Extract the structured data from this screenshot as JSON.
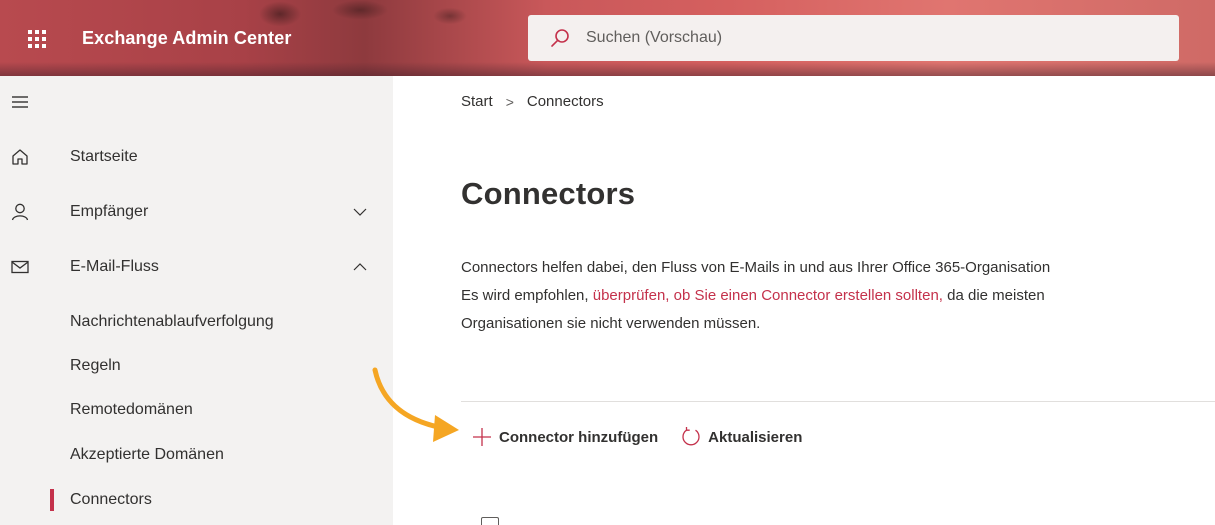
{
  "header": {
    "app_title": "Exchange Admin Center",
    "search_placeholder": "Suchen (Vorschau)",
    "launcher_icon": "waffle-icon",
    "search_icon": "search-icon"
  },
  "sidebar": {
    "collapse_icon": "hamburger-icon",
    "items": [
      {
        "label": "Startseite",
        "icon": "home-icon"
      },
      {
        "label": "Empfänger",
        "icon": "person-icon",
        "chevron": "chevron-down-icon"
      },
      {
        "label": "E-Mail-Fluss",
        "icon": "mail-icon",
        "chevron": "chevron-up-icon"
      }
    ],
    "subitems": [
      {
        "label": "Nachrichtenablaufverfolgung"
      },
      {
        "label": "Regeln"
      },
      {
        "label": "Remotedomänen"
      },
      {
        "label": "Akzeptierte Domänen"
      },
      {
        "label": "Connectors",
        "selected": true
      }
    ]
  },
  "main": {
    "breadcrumb": {
      "root": "Start",
      "separator": ">",
      "current": "Connectors"
    },
    "title": "Connectors",
    "description": {
      "line1": "Connectors helfen dabei, den Fluss von E-Mails in und aus Ihrer Office 365-Organisation",
      "line2_before": "Es wird empfohlen, ",
      "line2_link": "überprüfen, ob Sie einen Connector erstellen sollten,",
      "line2_after": " da die meisten",
      "line3": "Organisationen sie nicht verwenden müssen."
    },
    "commands": {
      "add_label": "Connector hinzufügen",
      "add_icon": "plus-icon",
      "refresh_label": "Aktualisieren",
      "refresh_icon": "refresh-icon"
    }
  },
  "colors": {
    "accent": "#c4314b",
    "annotation_arrow": "#f5a623",
    "sidebar_bg": "#f3f2f1",
    "text": "#323130"
  }
}
